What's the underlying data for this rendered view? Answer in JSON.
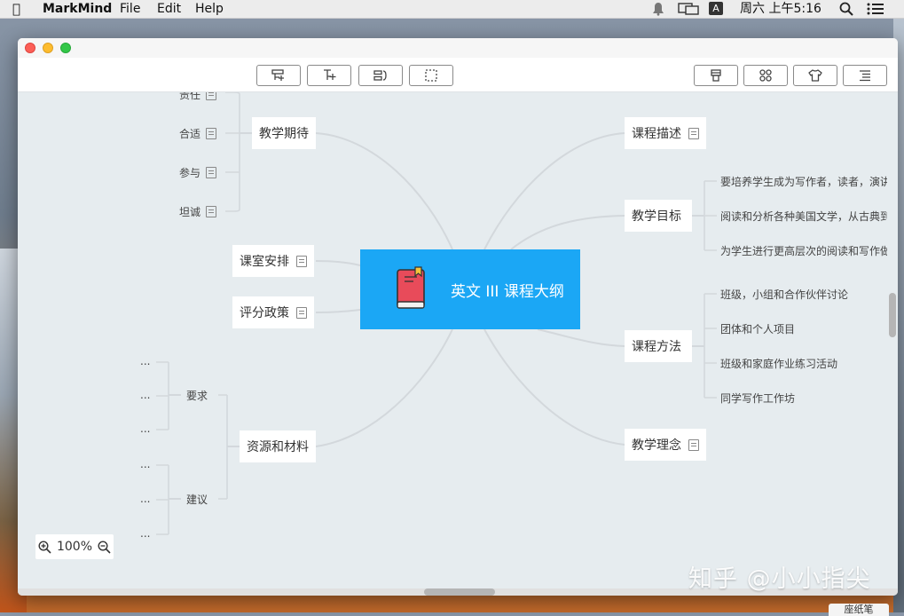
{
  "menubar": {
    "app_name": "MarkMind",
    "menus": [
      "File",
      "Edit",
      "Help"
    ],
    "clock": "周六 上午5:16",
    "input_source": "A"
  },
  "central": {
    "title": "英文 III 课程大纲"
  },
  "left_topics": {
    "expectation": {
      "label": "教学期待",
      "children": [
        "责任",
        "合适",
        "参与",
        "坦诚"
      ]
    },
    "arrangement": {
      "label": "课室安排"
    },
    "grading": {
      "label": "评分政策"
    },
    "resources": {
      "label": "资源和材料",
      "requirements": {
        "label": "要求",
        "children": [
          "...",
          "...",
          "..."
        ]
      },
      "suggestions": {
        "label": "建议",
        "children": [
          "...",
          "...",
          "..."
        ]
      }
    }
  },
  "right_topics": {
    "description": {
      "label": "课程描述"
    },
    "goals": {
      "label": "教学目标",
      "children": [
        "要培养学生成为写作者，读者，演讲",
        "阅读和分析各种美国文学，从古典到",
        "为学生进行更高层次的阅读和写作做"
      ]
    },
    "methods": {
      "label": "课程方法",
      "children": [
        "班级，小组和合作伙伴讨论",
        "团体和个人项目",
        "班级和家庭作业练习活动",
        "同学写作工作坊"
      ]
    },
    "philosophy": {
      "label": "教学理念"
    }
  },
  "zoom": {
    "level": "100%"
  },
  "watermark": "知乎 @小小指尖",
  "peek_label": "座纸笔",
  "colors": {
    "central": "#1ba7f5",
    "canvas": "#e6ecef",
    "connector": "#d3d8dc"
  }
}
